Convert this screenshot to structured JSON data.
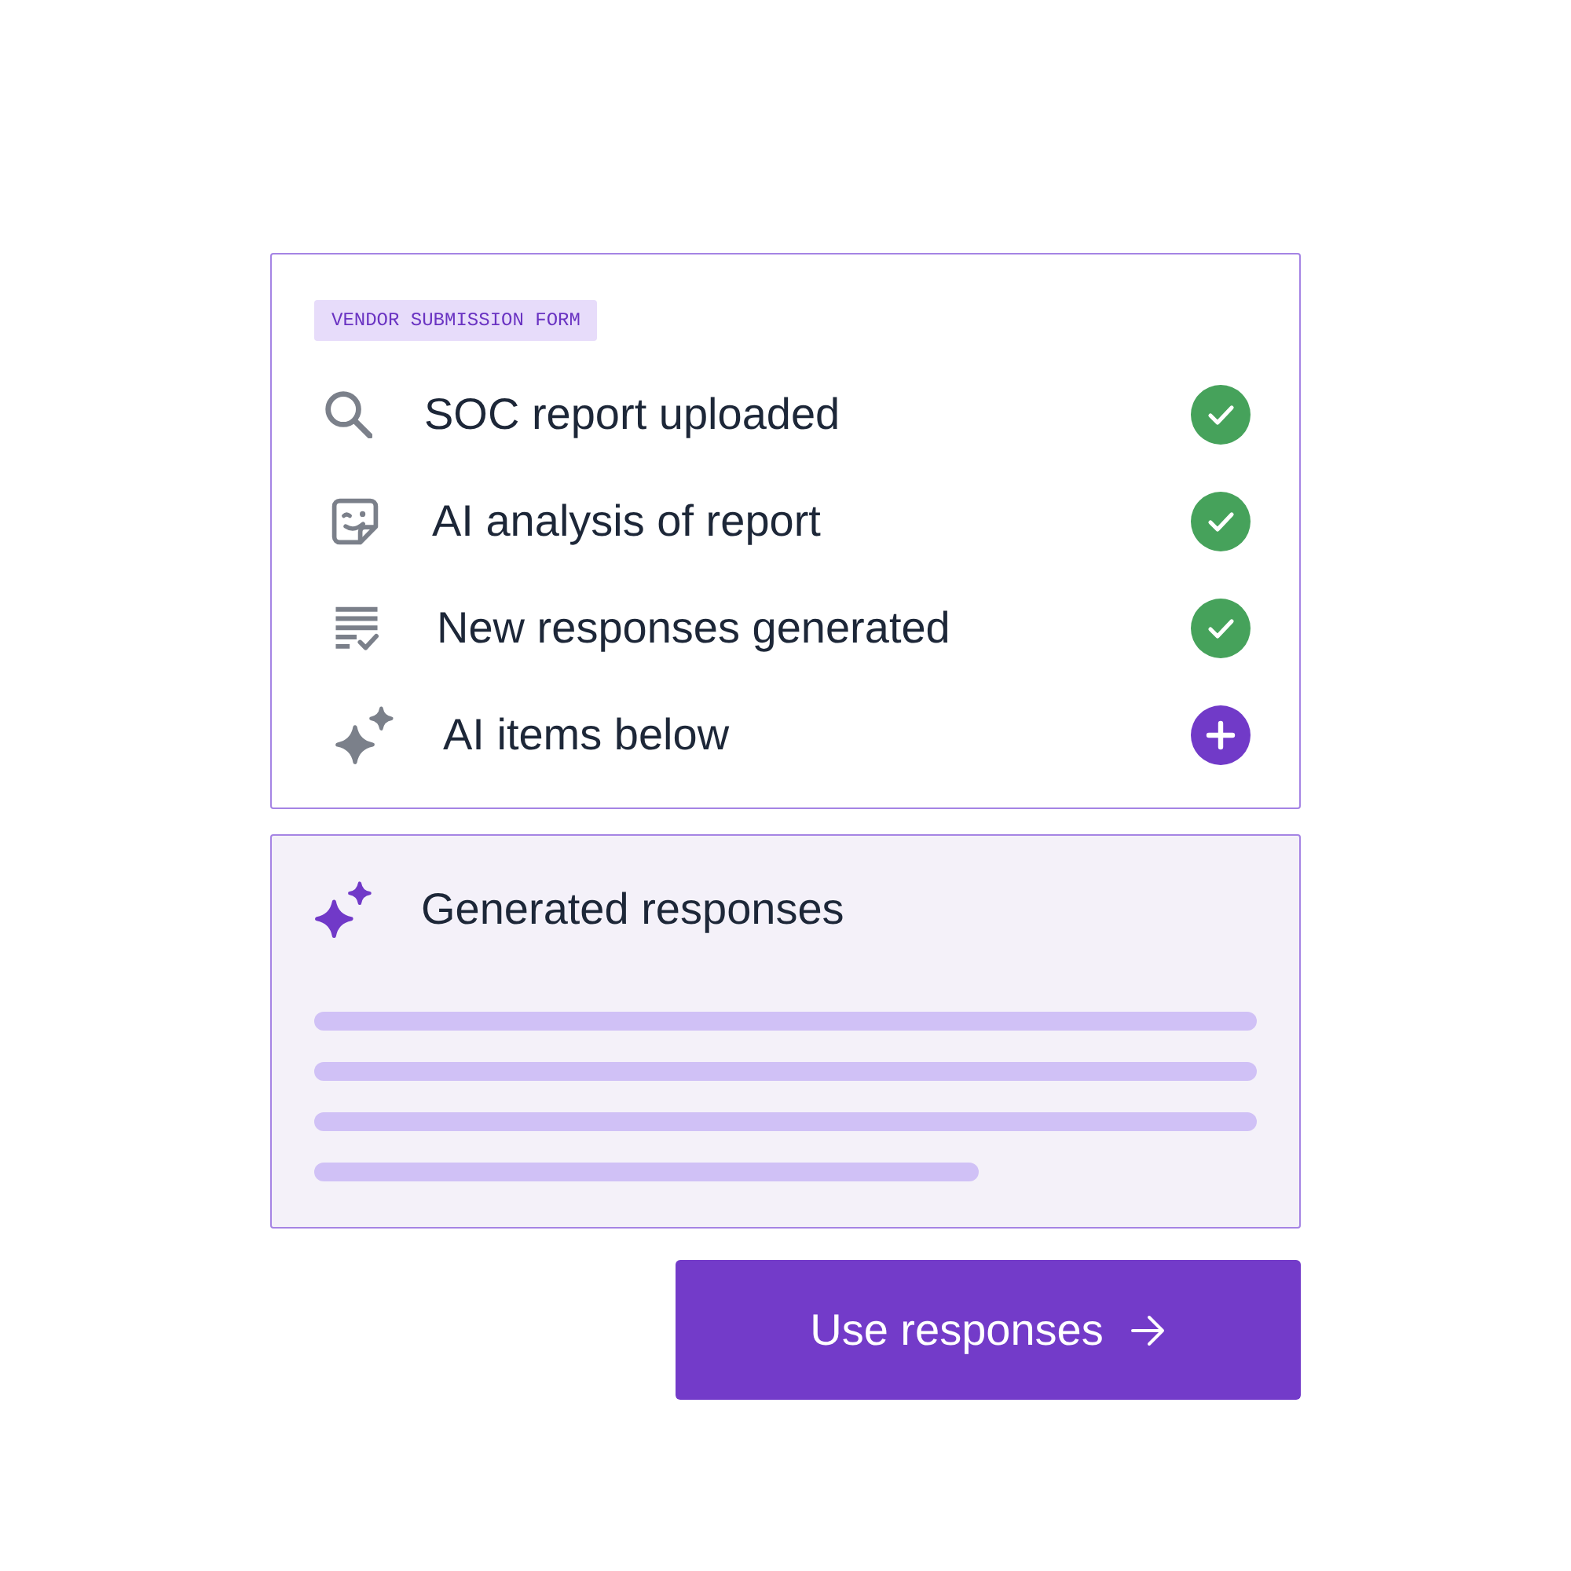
{
  "form_card": {
    "badge": "VENDOR SUBMISSION FORM",
    "steps": [
      {
        "label": "SOC report uploaded",
        "done": true
      },
      {
        "label": "AI analysis of report",
        "done": true
      },
      {
        "label": "New responses generated",
        "done": true
      },
      {
        "label": "AI items below",
        "done": false
      }
    ]
  },
  "responses_card": {
    "title": "Generated responses"
  },
  "primary_button": {
    "label": "Use responses"
  }
}
